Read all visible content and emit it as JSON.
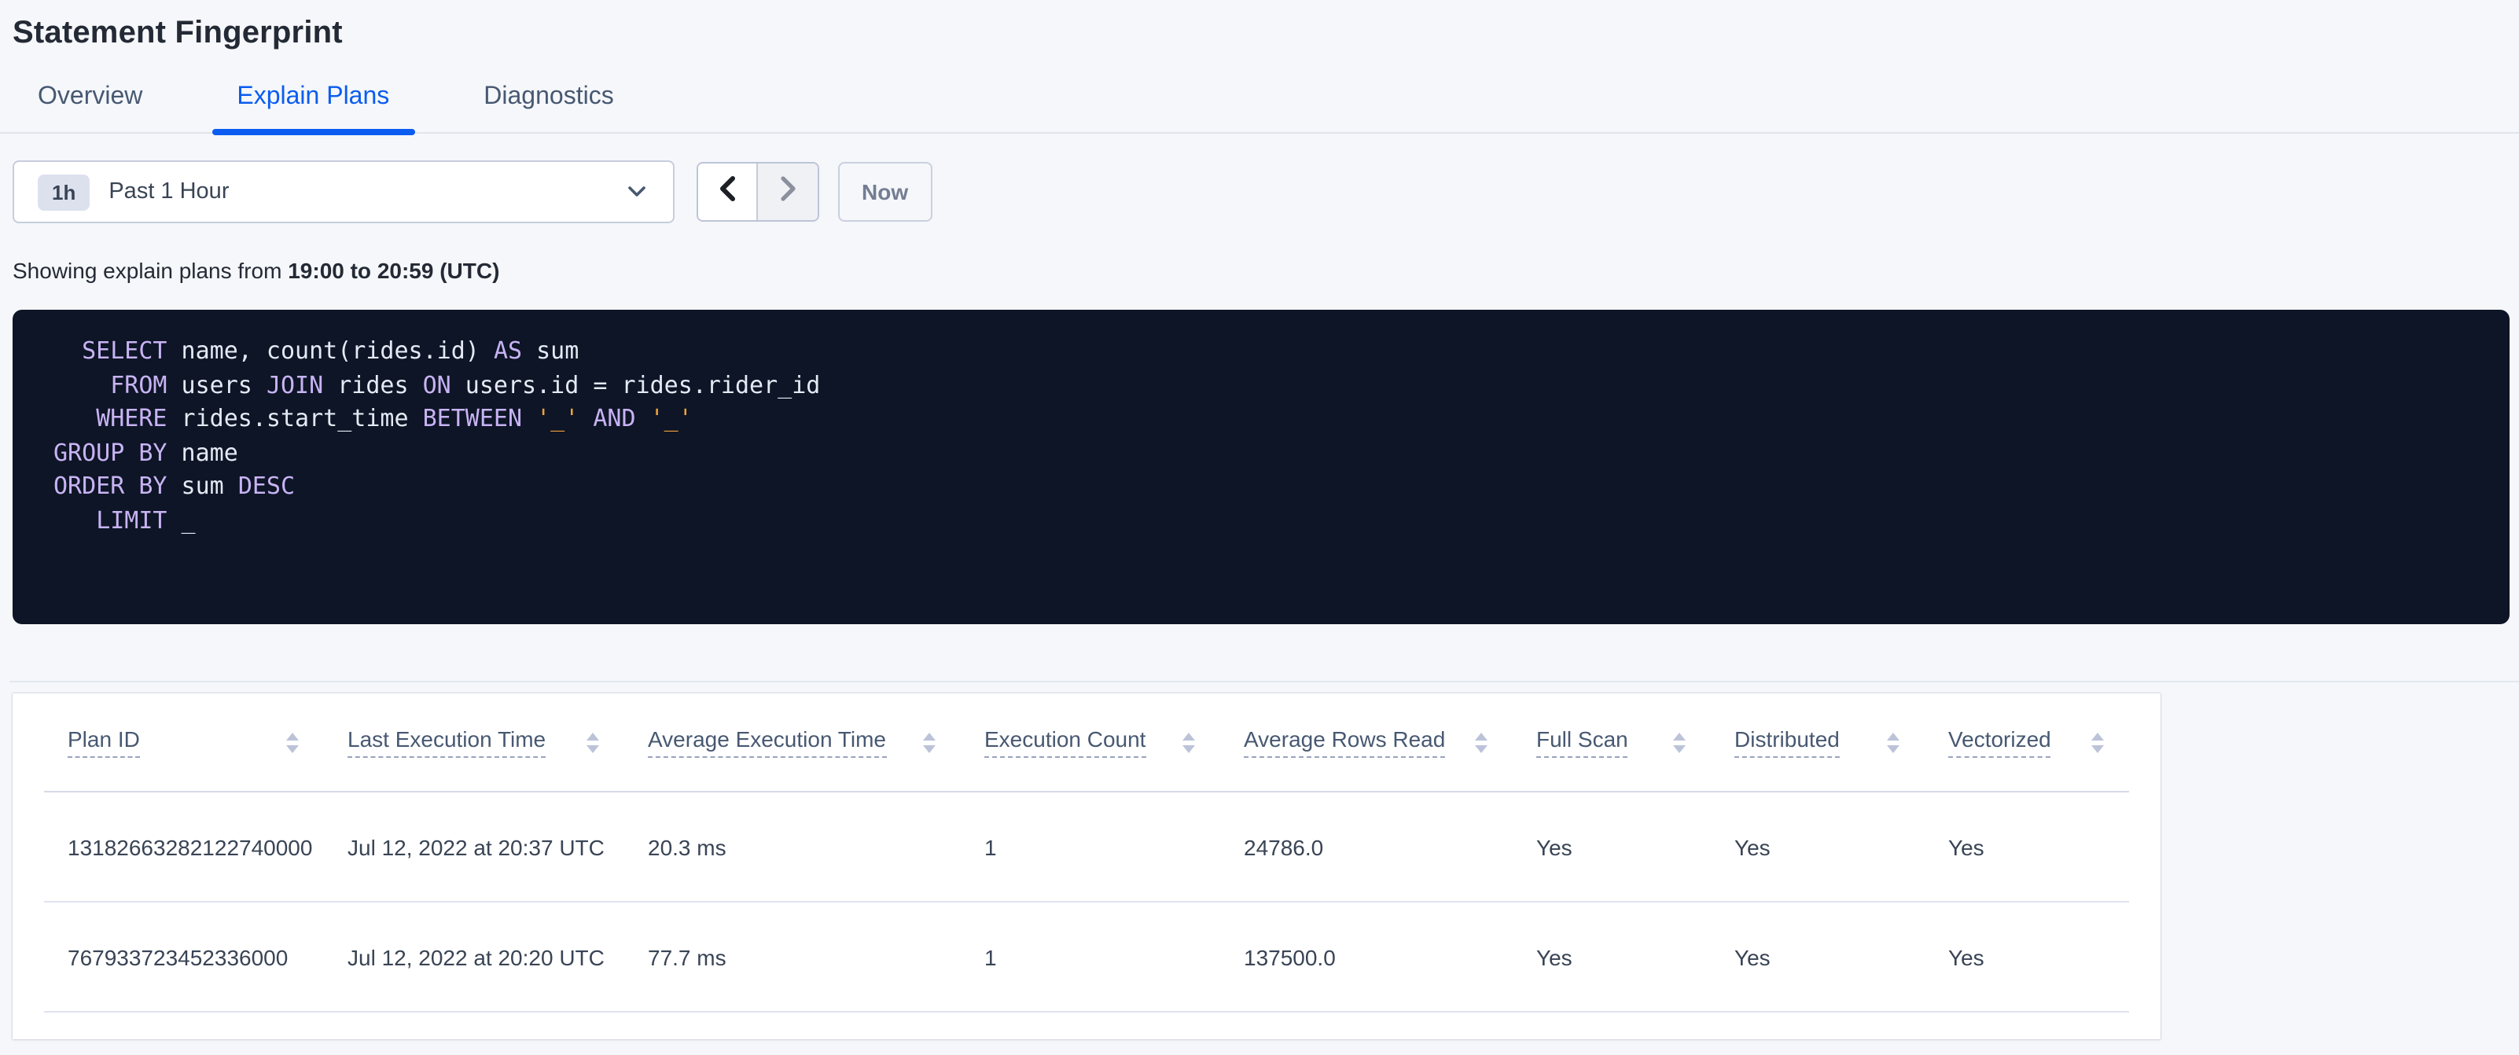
{
  "page": {
    "title": "Statement Fingerprint"
  },
  "tabs": [
    {
      "label": "Overview",
      "active": false
    },
    {
      "label": "Explain Plans",
      "active": true
    },
    {
      "label": "Diagnostics",
      "active": false
    }
  ],
  "time_picker": {
    "range_badge": "1h",
    "range_label": "Past 1 Hour",
    "now_label": "Now"
  },
  "summary": {
    "prefix": "Showing explain plans from ",
    "bold_range": "19:00 to 20:59 (UTC)"
  },
  "colors": {
    "accent_blue": "#0b5cf0",
    "code_background": "#0d1526",
    "sql_keyword": "#c8b3f3",
    "sql_plain": "#e4e9f4",
    "sql_literal": "#efa13b"
  },
  "sql": {
    "lines": [
      [
        {
          "t": "  ",
          "s": "p"
        },
        {
          "t": "SELECT",
          "s": "k"
        },
        {
          "t": " name, count(rides.id) ",
          "s": "p"
        },
        {
          "t": "AS",
          "s": "k"
        },
        {
          "t": " sum",
          "s": "p"
        }
      ],
      [
        {
          "t": "    ",
          "s": "p"
        },
        {
          "t": "FROM",
          "s": "k"
        },
        {
          "t": " users ",
          "s": "p"
        },
        {
          "t": "JOIN",
          "s": "k"
        },
        {
          "t": " rides ",
          "s": "p"
        },
        {
          "t": "ON",
          "s": "k"
        },
        {
          "t": " users.id = rides.rider_id",
          "s": "p"
        }
      ],
      [
        {
          "t": "   ",
          "s": "p"
        },
        {
          "t": "WHERE",
          "s": "k"
        },
        {
          "t": " rides.start_time ",
          "s": "p"
        },
        {
          "t": "BETWEEN",
          "s": "k"
        },
        {
          "t": " ",
          "s": "p"
        },
        {
          "t": "'_'",
          "s": "l"
        },
        {
          "t": " ",
          "s": "p"
        },
        {
          "t": "AND",
          "s": "k"
        },
        {
          "t": " ",
          "s": "p"
        },
        {
          "t": "'_'",
          "s": "l"
        }
      ],
      [
        {
          "t": "GROUP BY",
          "s": "k"
        },
        {
          "t": " name",
          "s": "p"
        }
      ],
      [
        {
          "t": "ORDER BY",
          "s": "k"
        },
        {
          "t": " sum ",
          "s": "p"
        },
        {
          "t": "DESC",
          "s": "k"
        }
      ],
      [
        {
          "t": "   ",
          "s": "p"
        },
        {
          "t": "LIMIT",
          "s": "k"
        },
        {
          "t": " _",
          "s": "p"
        }
      ]
    ]
  },
  "table": {
    "columns": [
      "Plan ID",
      "Last Execution Time",
      "Average Execution Time",
      "Execution Count",
      "Average Rows Read",
      "Full Scan",
      "Distributed",
      "Vectorized"
    ],
    "rows": [
      [
        "13182663282122740000",
        "Jul 12, 2022 at 20:37 UTC",
        "20.3 ms",
        "1",
        "24786.0",
        "Yes",
        "Yes",
        "Yes"
      ],
      [
        "767933723452336000",
        "Jul 12, 2022 at 20:20 UTC",
        "77.7 ms",
        "1",
        "137500.0",
        "Yes",
        "Yes",
        "Yes"
      ]
    ]
  }
}
